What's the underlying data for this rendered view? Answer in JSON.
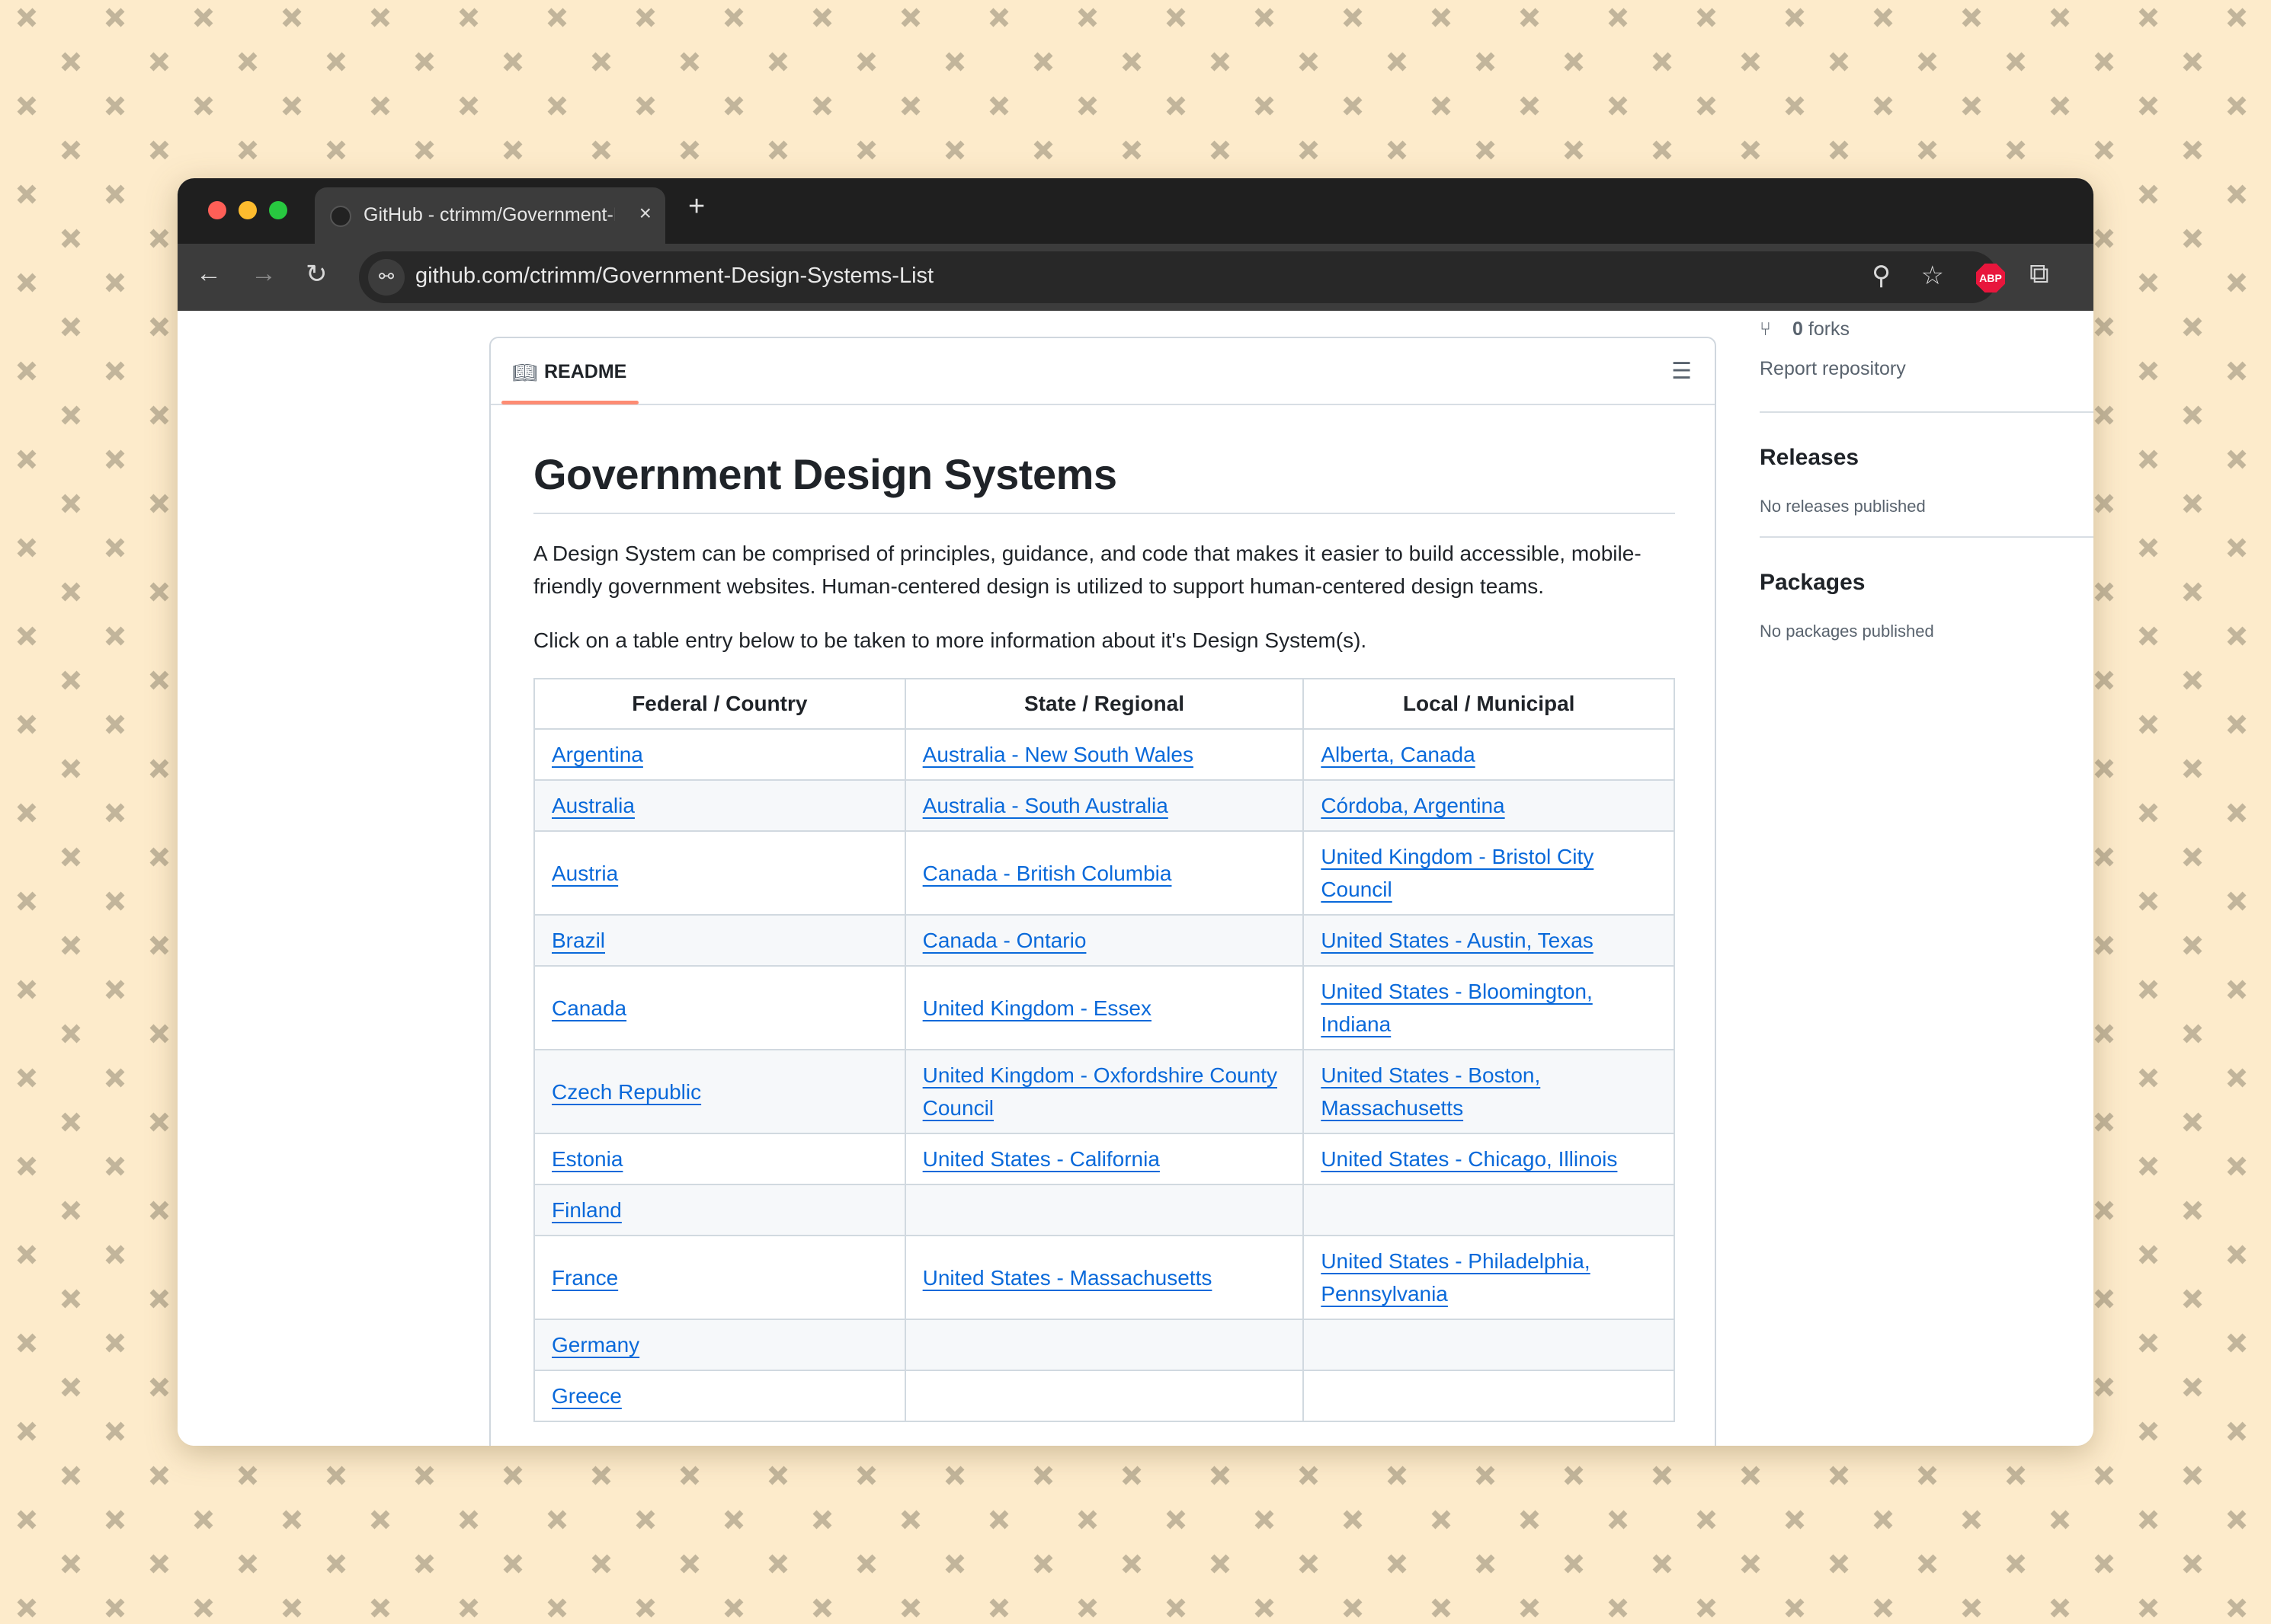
{
  "browser": {
    "tab_title": "GitHub - ctrimm/Government-Design-Systems-List",
    "new_tab_label": "+",
    "close_tab_label": "×",
    "url": "github.com/ctrimm/Government-Design-Systems-List",
    "extension_badge": "ABP"
  },
  "readme": {
    "tab_label": "README",
    "accent_color": "#fd8c73",
    "title": "Government Design Systems",
    "intro": "A Design System can be comprised of principles, guidance, and code that makes it easier to build accessible, mobile-friendly government websites. Human-centered design is utilized to support human-centered design teams.",
    "instruction": "Click on a table entry below to be taken to more information about it's Design System(s).",
    "table": {
      "headers": [
        "Federal / Country",
        "State / Regional",
        "Local / Municipal"
      ],
      "rows": [
        [
          "Argentina",
          "Australia - New South Wales",
          "Alberta, Canada"
        ],
        [
          "Australia",
          "Australia - South Australia",
          "Córdoba, Argentina"
        ],
        [
          "Austria",
          "Canada - British Columbia",
          "United Kingdom - Bristol City Council"
        ],
        [
          "Brazil",
          "Canada - Ontario",
          "United States - Austin, Texas"
        ],
        [
          "Canada",
          "United Kingdom - Essex",
          "United States - Bloomington, Indiana"
        ],
        [
          "Czech Republic",
          "United Kingdom - Oxfordshire County Council",
          "United States - Boston, Massachusetts"
        ],
        [
          "Estonia",
          "United States - California",
          "United States - Chicago, Illinois"
        ],
        [
          "Finland",
          "",
          ""
        ],
        [
          "France",
          "United States - Massachusetts",
          "United States - Philadelphia, Pennsylvania"
        ],
        [
          "Germany",
          "",
          ""
        ],
        [
          "Greece",
          "",
          ""
        ]
      ]
    }
  },
  "sidebar": {
    "forks_count": "0",
    "forks_label": "forks",
    "report_label": "Report repository",
    "releases_heading": "Releases",
    "releases_text": "No releases published",
    "packages_heading": "Packages",
    "packages_text": "No packages published"
  }
}
